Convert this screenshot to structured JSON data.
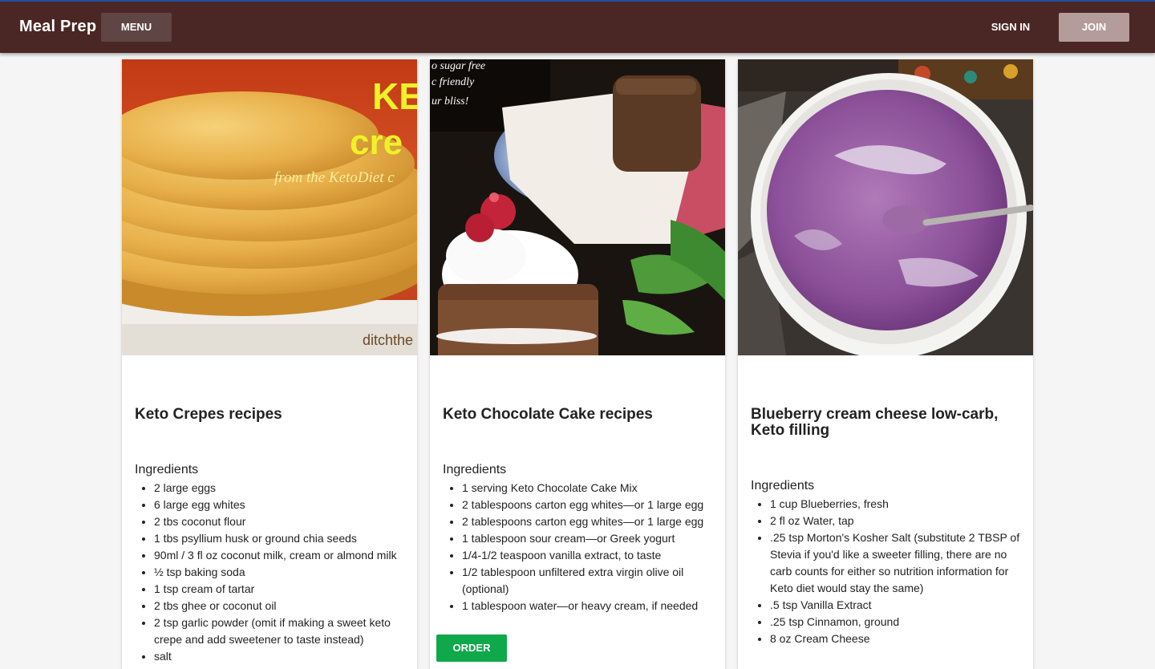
{
  "header": {
    "brand": "Meal Prep",
    "menu_label": "MENU",
    "signin_label": "SIGN IN",
    "join_label": "JOIN"
  },
  "cards": [
    {
      "image_text": {
        "line1": "KE",
        "line2": "cre",
        "line3": "from the KetoDiet c",
        "line4": "ditchthe"
      },
      "title": "Keto Crepes recipes",
      "ingredients_heading": "Ingredients",
      "ingredients": [
        "2 large eggs",
        "6 large egg whites",
        "2 tbs coconut flour",
        "1 tbs psyllium husk or ground chia seeds",
        "90ml / 3 fl oz coconut milk, cream or almond milk",
        "½ tsp baking soda",
        "1 tsp cream of tartar",
        "2 tbs ghee or coconut oil",
        "2 tsp garlic powder (omit if making a sweet keto crepe and add sweetener to taste instead)",
        "salt"
      ]
    },
    {
      "image_text": {
        "line1": "o sugar free",
        "line2": "c friendly",
        "line3": "ur bliss!"
      },
      "title": "Keto Chocolate Cake recipes",
      "ingredients_heading": "Ingredients",
      "ingredients": [
        "1 serving Keto Chocolate Cake Mix",
        "2 tablespoons carton egg whites—or 1 large egg",
        "2 tablespoons carton egg whites—or 1 large egg",
        "1 tablespoon sour cream—or Greek yogurt",
        "1/4-1/2 teaspoon vanilla extract, to taste",
        "1/2 tablespoon unfiltered extra virgin olive oil (optional)",
        "1 tablespoon water—or heavy cream, if needed"
      ],
      "order_label": "ORDER"
    },
    {
      "title": "Blueberry cream cheese low-carb, Keto filling",
      "ingredients_heading": "Ingredients",
      "ingredients": [
        "1 cup Blueberries, fresh",
        "2 fl oz Water, tap",
        ".25 tsp Morton's Kosher Salt (substitute 2 TBSP of Stevia if you'd like a sweeter filling, there are no carb counts for either so nutrition information for Keto diet would stay the same)",
        ".5 tsp Vanilla Extract",
        ".25 tsp Cinnamon, ground",
        "8 oz Cream Cheese"
      ]
    }
  ],
  "colors": {
    "header_bg": "#4a2725",
    "menu_bg": "#5f4644",
    "join_bg": "#b49c9b",
    "order_bg": "#0fa84a"
  }
}
